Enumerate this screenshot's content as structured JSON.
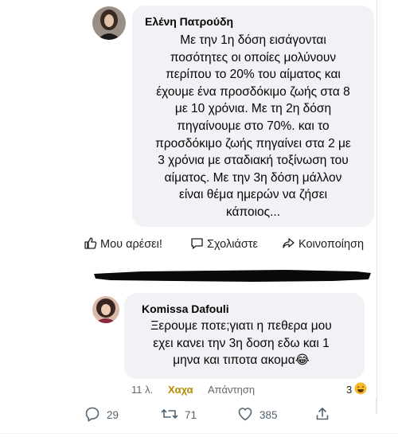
{
  "comment1": {
    "author": "Ελένη Πατρούδη",
    "lines": [
      "Με την 1η δόση εισάγονται",
      "ποσότητες οι οποίες μολύνουν",
      "περίπου το 20% του αίματος και",
      "έχουμε ένα προσδόκιμο ζωής στα 8",
      "με 10 χρόνια. Με τη 2η δόση",
      "πηγαίνουμε στο 70%. και το",
      "προσδόκιμο ζωής πηγαίνει στα 2 με",
      "3 χρόνια με σταδιακή τοξίνωση του",
      "αίματος. Με την 3η δόση μάλλον",
      "είναι θέμα ημερών να ζήσει",
      "κάποιος..."
    ]
  },
  "actions": {
    "like": "Μου αρέσει!",
    "comment": "Σχολιάστε",
    "share": "Κοινοποίηση"
  },
  "comment2": {
    "author": "Komissa Dafouli",
    "lines": [
      "Ξερουμε ποτε;γιατι η πεθερα μου",
      "εχει κανει την 3η δοση εδω και 1",
      "μηνα και τιποτα ακομα😂"
    ],
    "time": "11 λ.",
    "reaction_link": "Χαχα",
    "reply_link": "Απάντηση",
    "reaction_count": "3"
  },
  "tweet_actions": {
    "replies": "29",
    "retweets": "71",
    "likes": "385"
  },
  "colors": {
    "bubble": "#f0f2f5",
    "haha": "#b88a00",
    "muted": "#65676b"
  }
}
